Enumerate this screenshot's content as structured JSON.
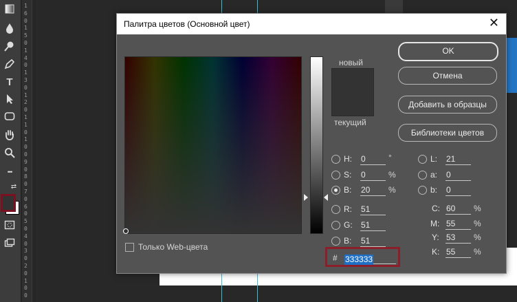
{
  "colors": {
    "current": "#333333",
    "highlight_border": "#8c1e2a",
    "selection": "#1f6fc4"
  },
  "toolbar": {
    "icons": [
      "gradient-icon",
      "drop-icon",
      "dodge-icon",
      "pen-icon",
      "type-icon",
      "path-select-icon",
      "shape-icon",
      "hand-icon",
      "zoom-icon",
      "more-icon",
      "swap-colors-icon",
      "quick-mask-icon",
      "screen-mode-icon"
    ],
    "type_glyph": "T",
    "more_glyph": "•••",
    "swap_glyph": "⇄"
  },
  "ruler": {
    "digits": [
      "1",
      "6",
      "0",
      "1",
      "5",
      "0",
      "1",
      "4",
      "0",
      "1",
      "3",
      "0",
      "1",
      "2",
      "0",
      "1",
      "1",
      "0",
      "1",
      "0",
      "0",
      "9",
      "0",
      "8",
      "0",
      "7",
      "0",
      "6",
      "0",
      "5",
      "0",
      "4",
      "0",
      "3",
      "0",
      "2",
      "0",
      "1",
      "0",
      "0"
    ]
  },
  "dialog": {
    "title": "Палитра цветов (Основной цвет)",
    "close": "✕",
    "new_label": "новый",
    "current_label": "текущий",
    "buttons": {
      "ok": "OK",
      "cancel": "Отмена",
      "add_swatches": "Добавить в образцы",
      "libraries": "Библиотеки цветов"
    },
    "hsb": [
      {
        "label": "H:",
        "value": "0",
        "unit": "°"
      },
      {
        "label": "S:",
        "value": "0",
        "unit": "%"
      },
      {
        "label": "B:",
        "value": "20",
        "unit": "%"
      }
    ],
    "rgb": [
      {
        "label": "R:",
        "value": "51"
      },
      {
        "label": "G:",
        "value": "51"
      },
      {
        "label": "B:",
        "value": "51"
      }
    ],
    "lab": [
      {
        "label": "L:",
        "value": "21"
      },
      {
        "label": "a:",
        "value": "0"
      },
      {
        "label": "b:",
        "value": "0"
      }
    ],
    "cmyk": [
      {
        "label": "C:",
        "value": "60",
        "unit": "%"
      },
      {
        "label": "M:",
        "value": "55",
        "unit": "%"
      },
      {
        "label": "Y:",
        "value": "53",
        "unit": "%"
      },
      {
        "label": "K:",
        "value": "55",
        "unit": "%"
      }
    ],
    "hex": {
      "label": "#",
      "value": "333333"
    },
    "web_only_label": "Только Web-цвета"
  }
}
